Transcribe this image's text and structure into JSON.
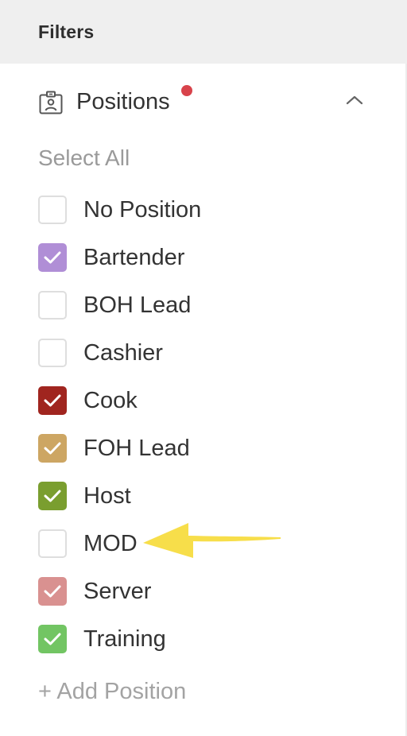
{
  "header": {
    "title": "Filters"
  },
  "section": {
    "title": "Positions",
    "icon": "id-badge-icon",
    "indicator_color": "#d8434b",
    "collapse_icon": "chevron-up-icon"
  },
  "select_all_label": "Select All",
  "options": [
    {
      "label": "No Position",
      "checked": false,
      "color": "#ffffff"
    },
    {
      "label": "Bartender",
      "checked": true,
      "color": "#b08ed6"
    },
    {
      "label": "BOH Lead",
      "checked": false,
      "color": "#ffffff"
    },
    {
      "label": "Cashier",
      "checked": false,
      "color": "#ffffff"
    },
    {
      "label": "Cook",
      "checked": true,
      "color": "#a0251f"
    },
    {
      "label": "FOH Lead",
      "checked": true,
      "color": "#cda663"
    },
    {
      "label": "Host",
      "checked": true,
      "color": "#7a9e2f"
    },
    {
      "label": "MOD",
      "checked": false,
      "color": "#ffffff"
    },
    {
      "label": "Server",
      "checked": true,
      "color": "#d99190"
    },
    {
      "label": "Training",
      "checked": true,
      "color": "#72c563"
    }
  ],
  "add_position_label": "+ Add Position",
  "annotation": {
    "arrow_color": "#f7de4a"
  }
}
